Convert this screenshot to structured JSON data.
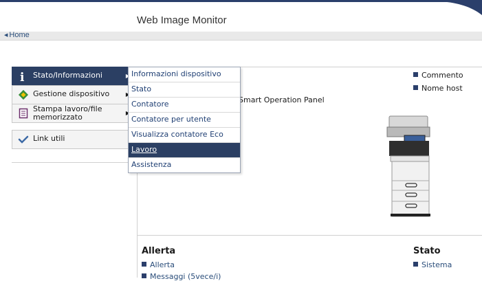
{
  "header": {
    "title": "Web Image Monitor",
    "home": "Home"
  },
  "sidebar": {
    "items": [
      {
        "label": "Stato/Informazioni",
        "icon": "info-icon",
        "active": true
      },
      {
        "label": "Gestione dispositivo",
        "icon": "device-management-icon"
      },
      {
        "label": "Stampa lavoro/file memorizzato",
        "line1": "Stampa lavoro/file",
        "line2": "memorizzato",
        "icon": "document-icon"
      },
      {
        "label": "Link utili",
        "icon": "link-icon"
      }
    ]
  },
  "dropdown": {
    "items": [
      "Informazioni dispositivo",
      "Stato",
      "Contatore",
      "Contatore per utente",
      "Visualizza contatore Eco",
      "Lavoro",
      "Assistenza"
    ],
    "selected": "Lavoro"
  },
  "main": {
    "panel_text": "Smart Operation Panel",
    "legend": [
      "Commento",
      "Nome host"
    ],
    "sections": {
      "allerta": {
        "title": "Allerta",
        "links": [
          "Allerta",
          "Messaggi (5vece/i)"
        ]
      },
      "stato": {
        "title": "Stato",
        "links": [
          "Sistema"
        ]
      }
    }
  },
  "colors": {
    "accent": "#2b3f63",
    "link": "#1f3f73"
  }
}
